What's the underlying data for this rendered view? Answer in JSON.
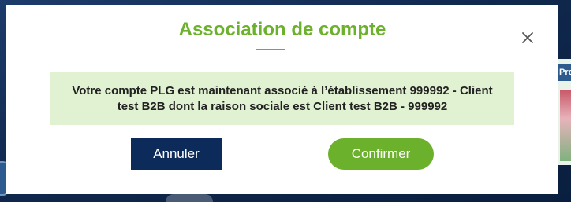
{
  "modal": {
    "title": "Association de compte",
    "close_icon": "close-icon",
    "message": "Votre compte PLG est maintenant associé à l’établissement 999992 - Client test B2B dont la raison sociale est Client test B2B - 999992",
    "cancel_label": "Annuler",
    "confirm_label": "Confirmer"
  },
  "background": {
    "promo_tab_text": "Pro"
  },
  "colors": {
    "accent_green": "#6cb12c",
    "message_bg": "#e0f2d1",
    "cancel_bg": "#0d2b5a",
    "overlay_bg": "#0f2a52"
  }
}
